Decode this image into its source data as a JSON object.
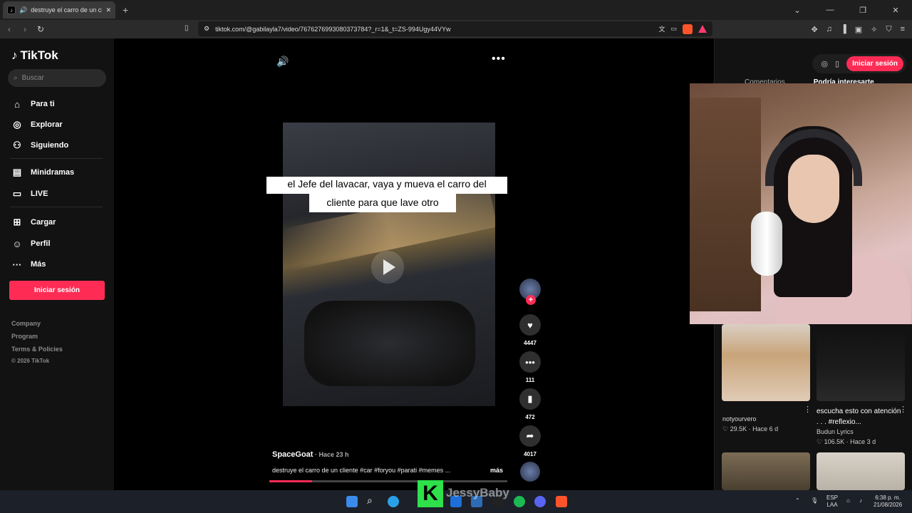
{
  "browser": {
    "tab_title": "destruye el carro de un cliente",
    "url": "tiktok.com/@gabilayla7/video/7676276993080373784?_r=1&_t=ZS-994Ugy44VYw",
    "newtab": "+",
    "icons": {
      "back": "chevron-left-icon",
      "forward": "chevron-right-icon",
      "reload": "reload-icon"
    }
  },
  "sidebar": {
    "logo": "TikTok",
    "search_placeholder": "Buscar",
    "items": [
      {
        "label": "Para ti",
        "icon": "home-icon"
      },
      {
        "label": "Explorar",
        "icon": "compass-icon"
      },
      {
        "label": "Siguiendo",
        "icon": "following-icon"
      },
      {
        "label": "Minidramas",
        "icon": "film-icon"
      },
      {
        "label": "LIVE",
        "icon": "live-tv-icon"
      },
      {
        "label": "Cargar",
        "icon": "upload-icon"
      },
      {
        "label": "Perfil",
        "icon": "profile-icon"
      },
      {
        "label": "Más",
        "icon": "more-icon"
      }
    ],
    "login": "Iniciar sesión",
    "footer": [
      "Company",
      "Program",
      "Terms & Policies"
    ],
    "copyright": "© 2026 TikTok"
  },
  "video": {
    "caption_line1": "el Jefe del  lavacar,  vaya y mueva el carro del",
    "caption_line2": "cliente para que lave otro",
    "author": "SpaceGoat",
    "time": " · Hace 23 h",
    "description": "destruye el carro de un cliente #car #foryou #parati #memes ...",
    "more": "más",
    "likes": "4447",
    "comments": "111",
    "saves": "472",
    "shares": "4017"
  },
  "right": {
    "login": "Iniciar sesión",
    "tab1": "Comentarios",
    "tab2": "Podría interesarte",
    "cards": [
      {
        "author": "notyourvero",
        "likes": "29.5K",
        "time": "Hace 6 d"
      },
      {
        "title": "escucha esto con atención . . . #reflexio...",
        "author": "Budun Lyrics",
        "likes": "106.5K",
        "time": "Hace 3 d"
      }
    ]
  },
  "overlay": {
    "letter": "K",
    "name": "JessyBaby"
  },
  "taskbar": {
    "lang1": "ESP",
    "lang2": "LAA",
    "time": "6:38 p. m.",
    "date": "21/08/2026"
  },
  "colors": {
    "accent": "#fe2c55"
  }
}
